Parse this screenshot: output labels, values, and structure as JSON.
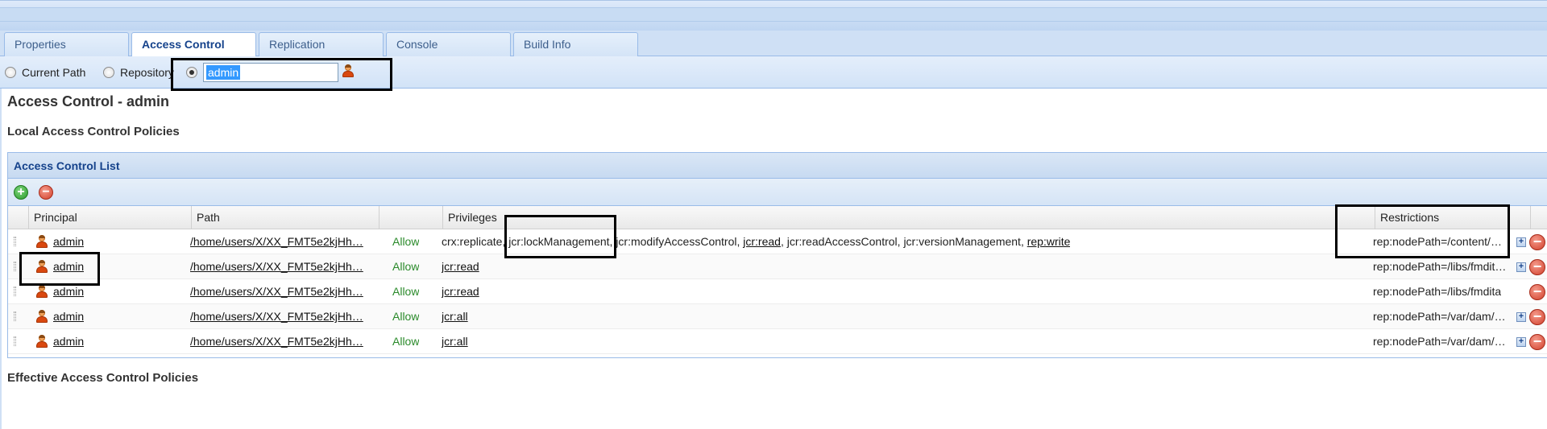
{
  "tabs": [
    {
      "label": "Properties",
      "active": false
    },
    {
      "label": "Access Control",
      "active": true
    },
    {
      "label": "Replication",
      "active": false
    },
    {
      "label": "Console",
      "active": false
    },
    {
      "label": "Build Info",
      "active": false
    }
  ],
  "scope": {
    "current_path_label": "Current Path",
    "repository_label": "Repository",
    "selected": "principal",
    "principal_value": "admin"
  },
  "page_title": "Access Control - admin",
  "local_policies_heading": "Local Access Control Policies",
  "effective_policies_heading": "Effective Access Control Policies",
  "acl": {
    "title": "Access Control List",
    "columns": {
      "principal": "Principal",
      "path": "Path",
      "type": "",
      "privileges": "Privileges",
      "restrictions": "Restrictions"
    },
    "rows": [
      {
        "principal": "admin",
        "path": "/home/users/X/XX_FMT5e2kjHh…",
        "type": "Allow",
        "privileges": [
          {
            "text": "crx:replicate",
            "link": false
          },
          {
            "text": ", ",
            "link": false
          },
          {
            "text": "jcr:lockManagement",
            "link": false
          },
          {
            "text": ", ",
            "link": false
          },
          {
            "text": "jcr:modifyAccessControl",
            "link": false
          },
          {
            "text": ", ",
            "link": false
          },
          {
            "text": "jcr:read",
            "link": true
          },
          {
            "text": ", ",
            "link": false
          },
          {
            "text": "jcr:readAccessControl",
            "link": false
          },
          {
            "text": ", ",
            "link": false
          },
          {
            "text": "jcr:versionManagement",
            "link": false
          },
          {
            "text": ", ",
            "link": false
          },
          {
            "text": "rep:write",
            "link": true
          }
        ],
        "restriction": "rep:nodePath=/content/…",
        "expandable": true
      },
      {
        "principal": "admin",
        "path": "/home/users/X/XX_FMT5e2kjHh…",
        "type": "Allow",
        "privileges": [
          {
            "text": "jcr:read",
            "link": true
          }
        ],
        "restriction": "rep:nodePath=/libs/fmdit…",
        "expandable": true
      },
      {
        "principal": "admin",
        "path": "/home/users/X/XX_FMT5e2kjHh…",
        "type": "Allow",
        "privileges": [
          {
            "text": "jcr:read",
            "link": true
          }
        ],
        "restriction": "rep:nodePath=/libs/fmdita",
        "expandable": false
      },
      {
        "principal": "admin",
        "path": "/home/users/X/XX_FMT5e2kjHh…",
        "type": "Allow",
        "privileges": [
          {
            "text": "jcr:all",
            "link": true
          }
        ],
        "restriction": "rep:nodePath=/var/dam/…",
        "expandable": true
      },
      {
        "principal": "admin",
        "path": "/home/users/X/XX_FMT5e2kjHh…",
        "type": "Allow",
        "privileges": [
          {
            "text": "jcr:all",
            "link": true
          }
        ],
        "restriction": "rep:nodePath=/var/dam/…",
        "expandable": true
      }
    ]
  },
  "icons": {
    "expand": "+",
    "remove": "−",
    "add": "+"
  },
  "colors": {
    "allow": "#2a8a2a",
    "header_text": "#15428b",
    "selection": "#3399ff"
  }
}
